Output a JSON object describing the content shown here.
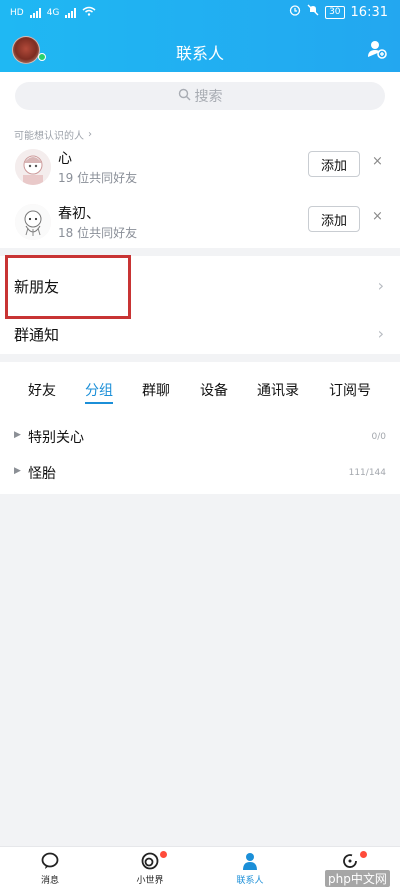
{
  "statusbar": {
    "time": "16:31",
    "battery": "30",
    "network_labels": [
      "HD",
      "4G",
      "HD",
      "4G"
    ]
  },
  "header": {
    "title": "联系人"
  },
  "search": {
    "placeholder": "搜索"
  },
  "suggest": {
    "heading": "可能想认识的人",
    "items": [
      {
        "name": "心",
        "mutual": "19 位共同好友",
        "add_label": "添加",
        "close": "×"
      },
      {
        "name": "春初、",
        "mutual": "18 位共同好友",
        "add_label": "添加",
        "close": "×"
      }
    ]
  },
  "rows": [
    {
      "label": "新朋友"
    },
    {
      "label": "群通知"
    }
  ],
  "tabs": [
    {
      "label": "好友"
    },
    {
      "label": "分组"
    },
    {
      "label": "群聊"
    },
    {
      "label": "设备"
    },
    {
      "label": "通讯录"
    },
    {
      "label": "订阅号"
    }
  ],
  "active_tab": "分组",
  "groups": [
    {
      "name": "特别关心",
      "count": "0/0"
    },
    {
      "name": "怪胎",
      "count": "111/144"
    }
  ],
  "tabbar": [
    {
      "label": "消息",
      "icon": "message-icon"
    },
    {
      "label": "小世界",
      "icon": "world-icon"
    },
    {
      "label": "联系人",
      "icon": "contacts-icon"
    },
    {
      "label": "动态",
      "icon": "refresh-icon"
    }
  ],
  "watermark": "php中文网",
  "colors": {
    "accent": "#1b8fd8",
    "header": "#1fb8f3",
    "highlight_box": "#c83434",
    "badge": "#ff4b3a"
  }
}
